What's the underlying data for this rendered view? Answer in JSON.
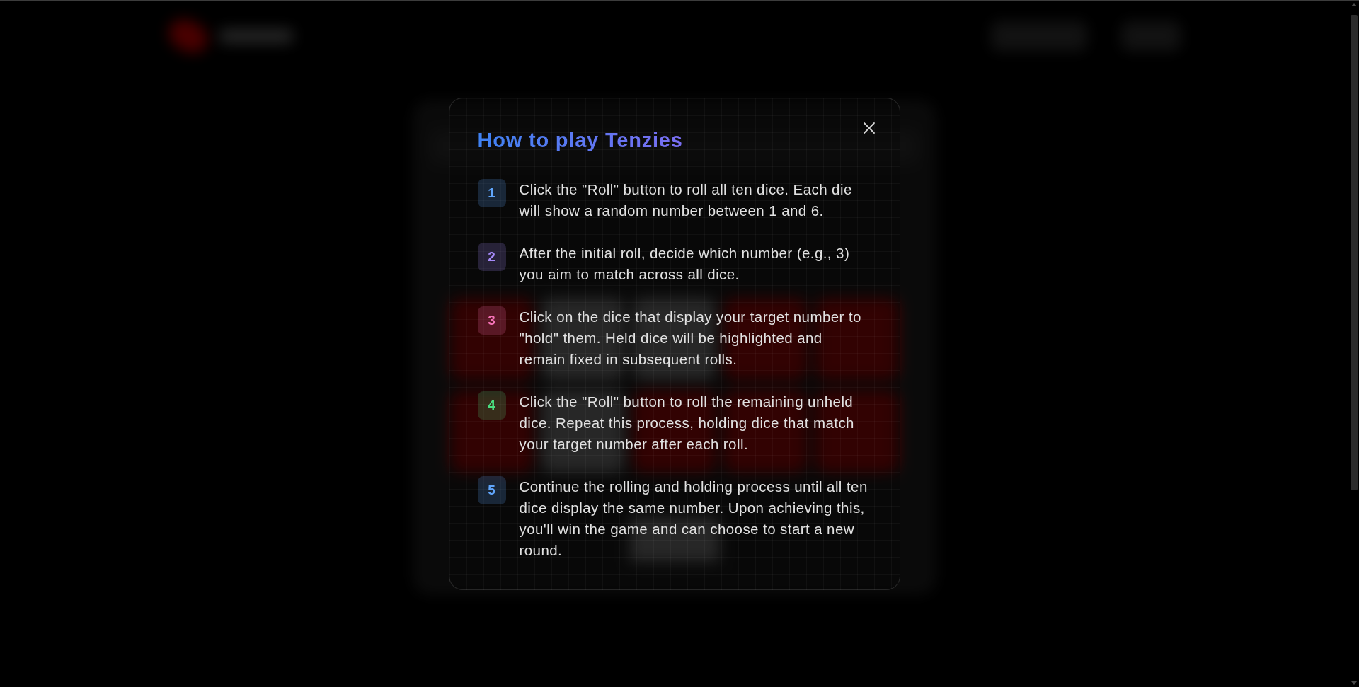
{
  "board": {
    "dice": [
      {
        "held": true
      },
      {
        "held": false
      },
      {
        "held": false
      },
      {
        "held": true
      },
      {
        "held": true
      },
      {
        "held": true
      },
      {
        "held": false
      },
      {
        "held": true
      },
      {
        "held": true
      },
      {
        "held": true
      }
    ]
  },
  "dialog": {
    "title": "How to play Tenzies",
    "steps": [
      {
        "number": "1",
        "color": "#60a5fa",
        "text": "Click the \"Roll\" button to roll all ten dice. Each die will show a random number between 1 and 6."
      },
      {
        "number": "2",
        "color": "#a78bfa",
        "text": "After the initial roll, decide which number (e.g., 3) you aim to match across all dice."
      },
      {
        "number": "3",
        "color": "#f472b6",
        "text": "Click on the dice that display your target number to \"hold\" them. Held dice will be highlighted and remain fixed in subsequent rolls."
      },
      {
        "number": "4",
        "color": "#4ade80",
        "text": "Click the \"Roll\" button to roll the remaining unheld dice. Repeat this process, holding dice that match your target number after each roll."
      },
      {
        "number": "5",
        "color": "#60a5fa",
        "text": "Continue the rolling and holding process until all ten dice display the same number. Upon achieving this, you'll win the game and can choose to start a new round."
      }
    ]
  }
}
